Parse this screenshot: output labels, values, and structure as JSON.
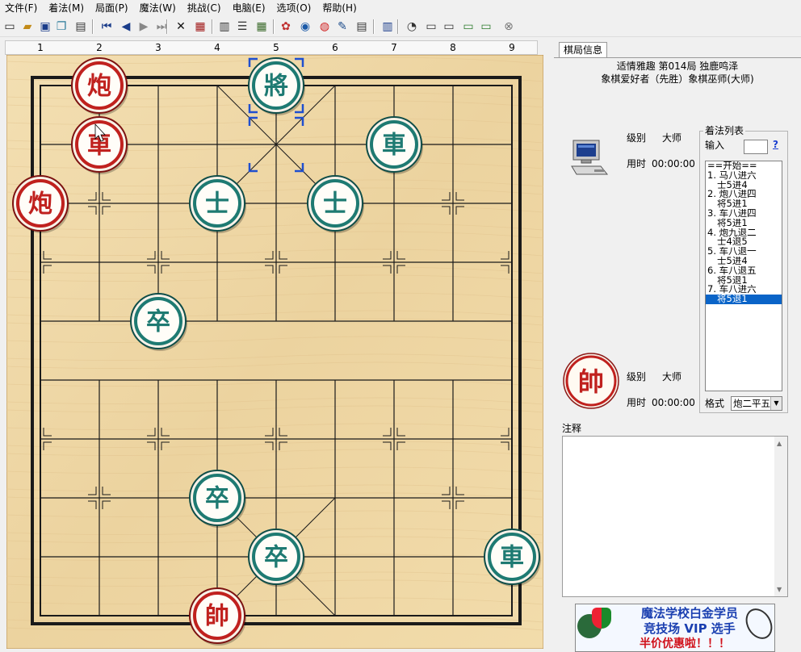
{
  "menu": [
    "文件(F)",
    "着法(M)",
    "局面(P)",
    "魔法(W)",
    "挑战(C)",
    "电脑(E)",
    "选项(O)",
    "帮助(H)"
  ],
  "toolbar_icons": [
    "new-icon",
    "open-icon",
    "save-icon",
    "copy-icon",
    "properties-icon",
    "first-move-icon",
    "prev-move-icon",
    "next-move-icon",
    "last-move-icon",
    "delete-icon",
    "paste-icon",
    "calendar-icon",
    "tree-icon",
    "calculator-icon",
    "palette-icon",
    "globe-icon",
    "weibo-icon",
    "script-icon",
    "clipboard-icon",
    "book-icon",
    "clock-icon",
    "engine1-icon",
    "engine2-icon",
    "engine3-icon",
    "chart-icon",
    "stop-icon"
  ],
  "files": [
    "1",
    "2",
    "3",
    "4",
    "5",
    "6",
    "7",
    "8",
    "9"
  ],
  "board": {
    "colors": {
      "wood": "#f0d9a8",
      "line": "#1a1a1a",
      "red": "#c0211e",
      "green": "#1e7a72",
      "selection": "#1f4fcf"
    },
    "pieces": [
      {
        "name": "red-cannon",
        "char": "炮",
        "side": "red",
        "file": 1,
        "rank": 0
      },
      {
        "name": "green-general",
        "char": "將",
        "side": "green",
        "file": 4,
        "rank": 0
      },
      {
        "name": "red-chariot",
        "char": "車",
        "side": "red",
        "file": 1,
        "rank": 1
      },
      {
        "name": "green-chariot",
        "char": "車",
        "side": "green",
        "file": 6,
        "rank": 1
      },
      {
        "name": "red-cannon",
        "char": "炮",
        "side": "red",
        "file": 0,
        "rank": 2
      },
      {
        "name": "green-advisor",
        "char": "士",
        "side": "green",
        "file": 3,
        "rank": 2
      },
      {
        "name": "green-advisor",
        "char": "士",
        "side": "green",
        "file": 5,
        "rank": 2
      },
      {
        "name": "green-soldier",
        "char": "卒",
        "side": "green",
        "file": 2,
        "rank": 4
      },
      {
        "name": "green-soldier",
        "char": "卒",
        "side": "green",
        "file": 3,
        "rank": 7
      },
      {
        "name": "green-chariot",
        "char": "車",
        "side": "green",
        "file": 8,
        "rank": 8
      },
      {
        "name": "green-soldier",
        "char": "卒",
        "side": "green",
        "file": 4,
        "rank": 8
      },
      {
        "name": "red-king",
        "char": "帥",
        "side": "red",
        "file": 3,
        "rank": 9
      }
    ],
    "selected": {
      "file": 4,
      "rank": 0
    }
  },
  "panel": {
    "tab": "棋局信息",
    "title_line": "适情雅趣 第014局 独鹿鸣泽",
    "players_line": "象棋爱好者（先胜）象棋巫师(大师)",
    "top_player": {
      "level_label": "级别",
      "level": "大师",
      "time_label": "用时",
      "time": "00:00:00",
      "icon": "computer-icon"
    },
    "bottom_player": {
      "level_label": "级别",
      "level": "大师",
      "time_label": "用时",
      "time": "00:00:00",
      "piece": "帥"
    },
    "movelist": {
      "title": "着法列表",
      "input_label": "输入",
      "help": "?",
      "moves": [
        {
          "text": "==开始==",
          "indent": false,
          "selected": false
        },
        {
          "text": "1. 马八进六",
          "indent": false,
          "selected": false
        },
        {
          "text": "士5进4",
          "indent": true,
          "selected": false
        },
        {
          "text": "2. 炮八进四",
          "indent": false,
          "selected": false
        },
        {
          "text": "将5进1",
          "indent": true,
          "selected": false
        },
        {
          "text": "3. 车八进四",
          "indent": false,
          "selected": false
        },
        {
          "text": "将5进1",
          "indent": true,
          "selected": false
        },
        {
          "text": "4. 炮九退二",
          "indent": false,
          "selected": false
        },
        {
          "text": "士4退5",
          "indent": true,
          "selected": false
        },
        {
          "text": "5. 车八退一",
          "indent": false,
          "selected": false
        },
        {
          "text": "士5进4",
          "indent": true,
          "selected": false
        },
        {
          "text": "6. 车八退五",
          "indent": false,
          "selected": false
        },
        {
          "text": "将5退1",
          "indent": true,
          "selected": false
        },
        {
          "text": "7. 车八进六",
          "indent": false,
          "selected": false
        },
        {
          "text": "将5退1",
          "indent": true,
          "selected": true
        }
      ],
      "format_label": "格式",
      "format_value": "炮二平五"
    },
    "notes_label": "注释",
    "ad": {
      "line1": "魔法学校白金学员",
      "line2": "竞技场 VIP 选手",
      "line3": "半价优惠啦！！！"
    }
  }
}
